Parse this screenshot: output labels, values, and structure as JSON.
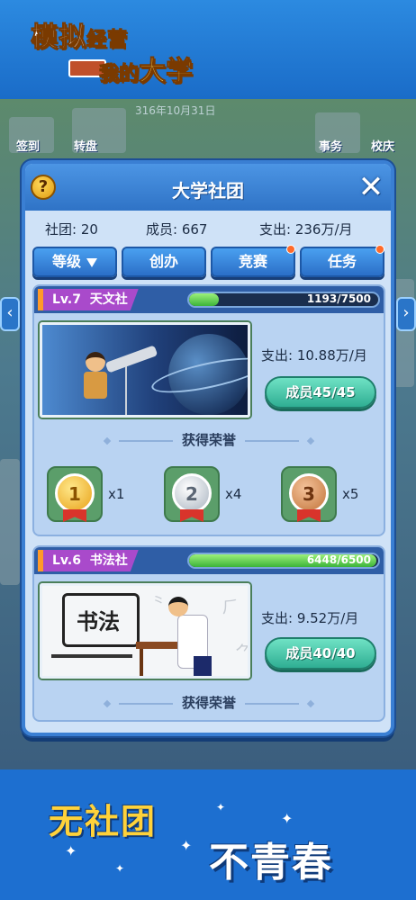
{
  "logo": {
    "line1": "模拟",
    "line1_small": "经营",
    "line2_small": "我的",
    "line2_big": "大学"
  },
  "scene": {
    "date": "316年10月31日",
    "left_label": "签到",
    "left_label2": "转盘",
    "right_label": "事务",
    "right_label2": "校庆"
  },
  "panel": {
    "title": "大学社团",
    "help_icon": "?",
    "close_icon": "✕"
  },
  "stats": {
    "clubs": "社团: 20",
    "members": "成员: 667",
    "expense": "支出: 236万/月"
  },
  "tabs": [
    {
      "label": "等级",
      "has_sort_arrow": true,
      "has_dot": false
    },
    {
      "label": "创办",
      "has_sort_arrow": false,
      "has_dot": false
    },
    {
      "label": "竞赛",
      "has_sort_arrow": false,
      "has_dot": true
    },
    {
      "label": "任务",
      "has_sort_arrow": false,
      "has_dot": true
    }
  ],
  "clubs": [
    {
      "level": "Lv.7",
      "name": "天文社",
      "progress_text": "1193/7500",
      "progress_fraction": 0.159,
      "expense": "支出: 10.88万/月",
      "members_button": "成员45/45",
      "honors_title": "获得荣誉",
      "medals": [
        {
          "type": "gold",
          "rank": "1",
          "count": "x1"
        },
        {
          "type": "silver",
          "rank": "2",
          "count": "x4"
        },
        {
          "type": "bronze",
          "rank": "3",
          "count": "x5"
        }
      ]
    },
    {
      "level": "Lv.6",
      "name": "书法社",
      "progress_text": "6448/6500",
      "progress_fraction": 0.992,
      "expense": "支出: 9.52万/月",
      "members_button": "成员40/40",
      "honors_title": "获得荣誉",
      "seal_text": "书法"
    }
  ],
  "slogan": {
    "line1": "无社团",
    "line2": "不青春"
  },
  "colors": {
    "panel_border": "#3a7fd3",
    "level_tag": "#a94acb",
    "progress_green": "#3cb43a",
    "member_button": "#2fae93",
    "slogan_yellow": "#ffd23a"
  }
}
